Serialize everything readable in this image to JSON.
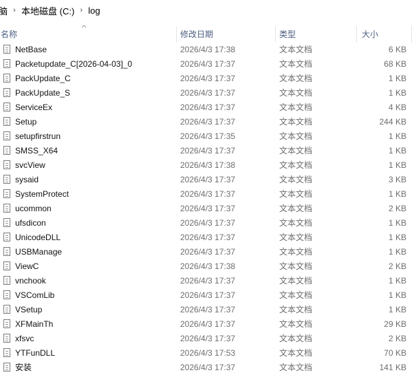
{
  "breadcrumb": {
    "items": [
      "脑",
      "本地磁盘 (C:)",
      "log"
    ],
    "separator": "›"
  },
  "columns": {
    "name": "名称",
    "date": "修改日期",
    "type": "类型",
    "size": "大小"
  },
  "files": [
    {
      "name": "NetBase",
      "date": "2026/4/3 17:38",
      "type": "文本文档",
      "size": "6 KB"
    },
    {
      "name": "Packetupdate_C[2026-04-03]_0",
      "date": "2026/4/3 17:37",
      "type": "文本文档",
      "size": "68 KB"
    },
    {
      "name": "PackUpdate_C",
      "date": "2026/4/3 17:37",
      "type": "文本文档",
      "size": "1 KB"
    },
    {
      "name": "PackUpdate_S",
      "date": "2026/4/3 17:37",
      "type": "文本文档",
      "size": "1 KB"
    },
    {
      "name": "ServiceEx",
      "date": "2026/4/3 17:37",
      "type": "文本文档",
      "size": "4 KB"
    },
    {
      "name": "Setup",
      "date": "2026/4/3 17:37",
      "type": "文本文档",
      "size": "244 KB"
    },
    {
      "name": "setupfirstrun",
      "date": "2026/4/3 17:35",
      "type": "文本文档",
      "size": "1 KB"
    },
    {
      "name": "SMSS_X64",
      "date": "2026/4/3 17:37",
      "type": "文本文档",
      "size": "1 KB"
    },
    {
      "name": "svcView",
      "date": "2026/4/3 17:38",
      "type": "文本文档",
      "size": "1 KB"
    },
    {
      "name": "sysaid",
      "date": "2026/4/3 17:37",
      "type": "文本文档",
      "size": "3 KB"
    },
    {
      "name": "SystemProtect",
      "date": "2026/4/3 17:37",
      "type": "文本文档",
      "size": "1 KB"
    },
    {
      "name": "ucommon",
      "date": "2026/4/3 17:37",
      "type": "文本文档",
      "size": "2 KB"
    },
    {
      "name": "ufsdicon",
      "date": "2026/4/3 17:37",
      "type": "文本文档",
      "size": "1 KB"
    },
    {
      "name": "UnicodeDLL",
      "date": "2026/4/3 17:37",
      "type": "文本文档",
      "size": "1 KB"
    },
    {
      "name": "USBManage",
      "date": "2026/4/3 17:37",
      "type": "文本文档",
      "size": "1 KB"
    },
    {
      "name": "ViewC",
      "date": "2026/4/3 17:38",
      "type": "文本文档",
      "size": "2 KB"
    },
    {
      "name": "vnchook",
      "date": "2026/4/3 17:37",
      "type": "文本文档",
      "size": "1 KB"
    },
    {
      "name": "VSComLib",
      "date": "2026/4/3 17:37",
      "type": "文本文档",
      "size": "1 KB"
    },
    {
      "name": "VSetup",
      "date": "2026/4/3 17:37",
      "type": "文本文档",
      "size": "1 KB"
    },
    {
      "name": "XFMainTh",
      "date": "2026/4/3 17:37",
      "type": "文本文档",
      "size": "29 KB"
    },
    {
      "name": "xfsvc",
      "date": "2026/4/3 17:37",
      "type": "文本文档",
      "size": "2 KB"
    },
    {
      "name": "YTFunDLL",
      "date": "2026/4/3 17:53",
      "type": "文本文档",
      "size": "70 KB"
    },
    {
      "name": "安装",
      "date": "2026/4/3 17:37",
      "type": "文本文档",
      "size": "141 KB"
    }
  ],
  "icons": {
    "file": "text-file-icon",
    "sort": "sort-ascending-icon"
  }
}
